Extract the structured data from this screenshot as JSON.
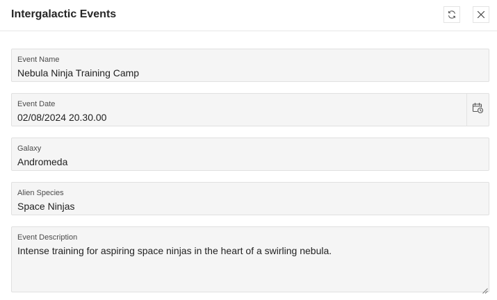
{
  "dialog": {
    "title": "Intergalactic Events",
    "refresh_icon": "refresh-icon",
    "close_icon": "close-icon"
  },
  "fields": {
    "event_name": {
      "label": "Event Name",
      "value": "Nebula Ninja Training Camp"
    },
    "event_date": {
      "label": "Event Date",
      "value": "02/08/2024 20.30.00",
      "icon": "calendar-clock-icon"
    },
    "galaxy": {
      "label": "Galaxy",
      "value": "Andromeda"
    },
    "alien_species": {
      "label": "Alien Species",
      "value": "Space Ninjas"
    },
    "event_description": {
      "label": "Event Description",
      "value": "Intense training for aspiring space ninjas in the heart of a swirling nebula."
    }
  },
  "colors": {
    "field_background": "#f5f5f5",
    "field_border": "#e0e0e0",
    "text": "#1f1f1f"
  }
}
